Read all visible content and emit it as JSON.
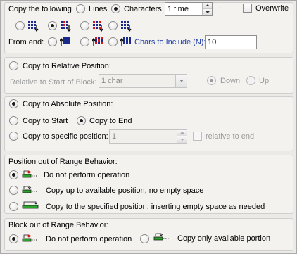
{
  "copy": {
    "label": "Copy the following",
    "mode_lines": "Lines",
    "mode_characters": "Characters",
    "count_value": "1 time",
    "colon": ":",
    "overwrite": "Overwrite",
    "from_end": "From end:",
    "chars_to_include_label": "Chars to Include (N):",
    "chars_to_include_value": "10"
  },
  "relative": {
    "title": "Copy to Relative Position:",
    "relative_label": "Relative to Start of Block:",
    "relative_value": "1 char",
    "down": "Down",
    "up": "Up"
  },
  "absolute": {
    "title": "Copy to Absolute Position:",
    "to_start": "Copy to Start",
    "to_end": "Copy to End",
    "specific": "Copy to specific position:",
    "specific_value": "1",
    "relative_to_end": "relative to end"
  },
  "position_range": {
    "title": "Position out of Range Behavior:",
    "opt1": "Do not perform operation",
    "opt2": "Copy up to available position, no empty space",
    "opt3": "Copy to the specified position, inserting empty space as needed"
  },
  "block_range": {
    "title": "Block out of Range Behavior:",
    "opt1": "Do not perform operation",
    "opt2": "Copy only available portion"
  },
  "colors": {
    "accent_blue": "#1f3ea8",
    "icon_red": "#d81818",
    "icon_green": "#2aa52a",
    "icon_navy": "#1a2a8a"
  }
}
